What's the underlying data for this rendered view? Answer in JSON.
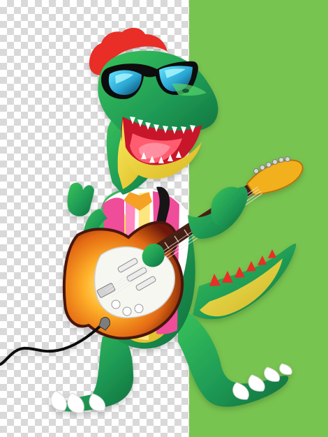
{
  "scene": {
    "subject": "",
    "colors": {
      "checker_light": "#ffffff",
      "checker_dark": "#d9d9d9",
      "background_green": "#78c450",
      "dino_green": "#1f9b55",
      "dino_dark_green": "#0f6f3c",
      "belly_yellow": "#f1d52c",
      "spikes_red": "#e82f26",
      "shirt_pink": "#ef4e9a",
      "guitar_sunburst": "#f28b1e",
      "guitar_pickguard": "#f7f7f2",
      "lens_blue": "#2fb7d7"
    }
  }
}
